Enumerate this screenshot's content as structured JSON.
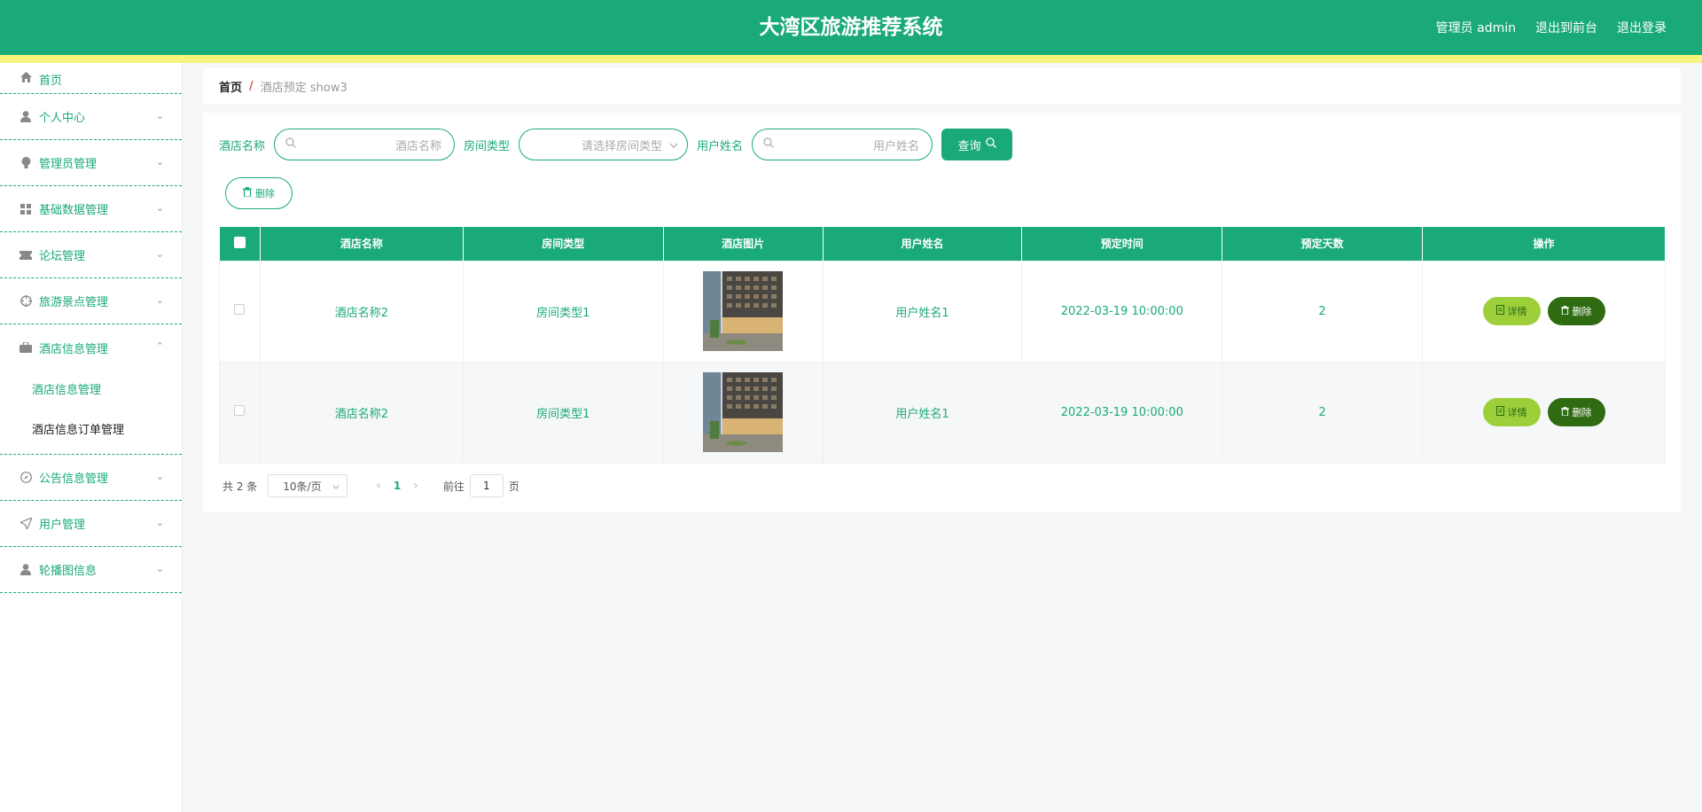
{
  "header": {
    "title": "大湾区旅游推荐系统",
    "admin_label": "管理员 admin",
    "to_front_label": "退出到前台",
    "logout_label": "退出登录"
  },
  "sidebar": {
    "items": [
      {
        "label": "首页",
        "icon": "home-icon"
      },
      {
        "label": "个人中心",
        "icon": "user-icon"
      },
      {
        "label": "管理员管理",
        "icon": "bulb-icon"
      },
      {
        "label": "基础数据管理",
        "icon": "grid-icon"
      },
      {
        "label": "论坛管理",
        "icon": "ticket-icon"
      },
      {
        "label": "旅游景点管理",
        "icon": "target-icon"
      },
      {
        "label": "酒店信息管理",
        "icon": "briefcase-icon"
      },
      {
        "label": "公告信息管理",
        "icon": "compass-icon"
      },
      {
        "label": "用户管理",
        "icon": "send-icon"
      },
      {
        "label": "轮播图信息",
        "icon": "user-icon"
      }
    ],
    "submenu": [
      {
        "label": "酒店信息管理"
      },
      {
        "label": "酒店信息订单管理"
      }
    ]
  },
  "breadcrumb": {
    "home": "首页",
    "separator": "/",
    "current": "酒店预定 show3"
  },
  "filters": {
    "hotel_name_label": "酒店名称",
    "hotel_name_placeholder": "酒店名称",
    "room_type_label": "房间类型",
    "room_type_placeholder": "请选择房间类型",
    "user_name_label": "用户姓名",
    "user_name_placeholder": "用户姓名",
    "query_label": "查询",
    "bulk_delete_label": "删除"
  },
  "table": {
    "columns": [
      "酒店名称",
      "房间类型",
      "酒店图片",
      "用户姓名",
      "预定时间",
      "预定天数",
      "操作"
    ],
    "rows": [
      {
        "hotel": "酒店名称2",
        "room": "房间类型1",
        "user": "用户姓名1",
        "time": "2022-03-19 10:00:00",
        "days": "2",
        "detail": "详情",
        "delete": "删除"
      },
      {
        "hotel": "酒店名称2",
        "room": "房间类型1",
        "user": "用户姓名1",
        "time": "2022-03-19 10:00:00",
        "days": "2",
        "detail": "详情",
        "delete": "删除"
      }
    ]
  },
  "pagination": {
    "total": "共 2 条",
    "page_size": "10条/页",
    "current_page": "1",
    "goto_label": "前往",
    "goto_value": "1",
    "page_unit": "页"
  },
  "colors": {
    "primary": "#1aaa78",
    "accent_strip": "#f6f47a",
    "detail_button": "#9ccf3a",
    "delete_button": "#2f6b10"
  }
}
